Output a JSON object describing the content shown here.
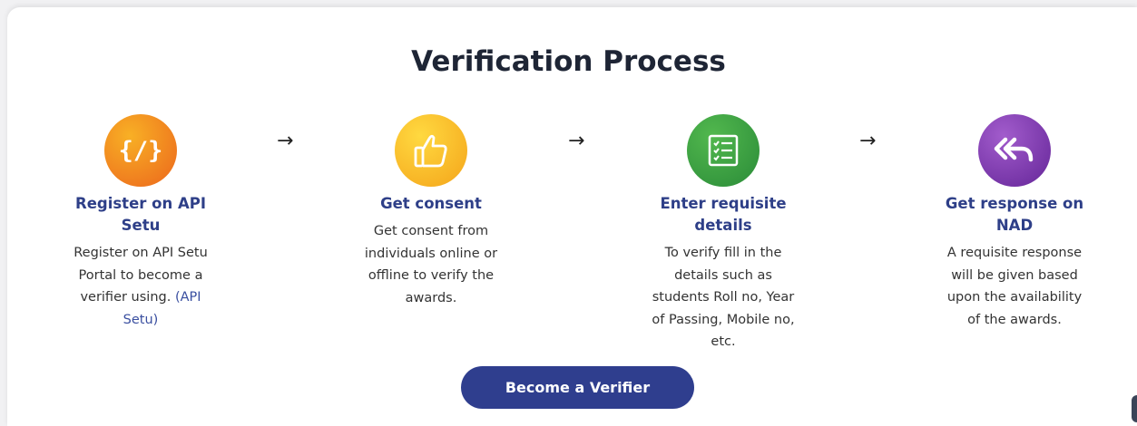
{
  "section": {
    "title": "Verification Process"
  },
  "steps": [
    {
      "icon": "code-icon",
      "title": "Register on API Setu",
      "desc": "Register on API Setu Portal to become a verifier using.",
      "link": "(API Setu)",
      "color_from": "#f7a020",
      "color_to": "#ef6b1f"
    },
    {
      "icon": "thumbs-up-icon",
      "title": "Get consent",
      "desc": "Get consent from individuals online or offline to verify the awards.",
      "color_from": "#ffd23a",
      "color_to": "#f6a81c"
    },
    {
      "icon": "checklist-icon",
      "title": "Enter requisite details",
      "desc": "To verify fill in the details such as students Roll no, Year of Passing, Mobile no, etc.",
      "color_from": "#4cb04c",
      "color_to": "#2b8f3a"
    },
    {
      "icon": "reply-all-icon",
      "title": "Get response on NAD",
      "desc": "A requisite response will be given based upon the availability of the awards.",
      "color_from": "#9a4fc4",
      "color_to": "#6a2a9c"
    }
  ],
  "arrows": [
    "→",
    "→",
    "→"
  ],
  "cta": {
    "label": "Become a Verifier"
  },
  "colors": {
    "heading": "#1e2535",
    "step_title": "#2e3f88",
    "button_bg": "#2f3e8e"
  }
}
